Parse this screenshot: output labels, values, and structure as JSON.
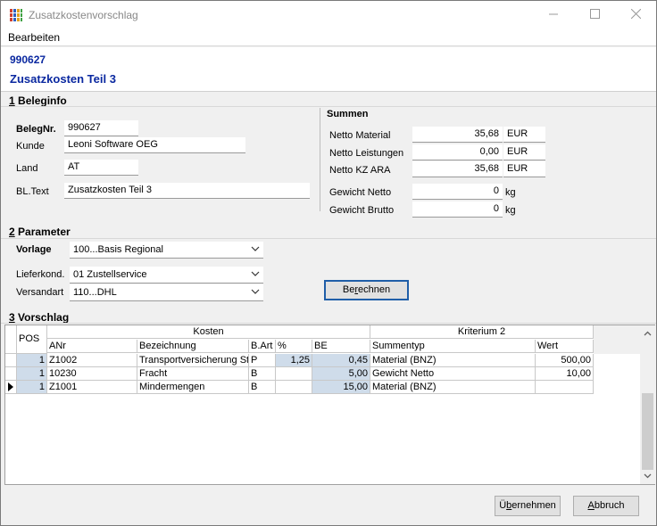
{
  "window": {
    "title": "Zusatzkostenvorschlag"
  },
  "menu": {
    "edit": "Bearbeiten"
  },
  "header": {
    "number": "990627",
    "title": "Zusatzkosten Teil 3"
  },
  "beleginfo": {
    "section_prefix": "1",
    "section_label": " Beleginfo",
    "belegnr_label": "BelegNr.",
    "belegnr": "990627",
    "kunde_label": "Kunde",
    "kunde": "Leoni Software OEG",
    "land_label": "Land",
    "land": "AT",
    "bltext_label": "BL.Text",
    "bltext": "Zusatzkosten Teil 3"
  },
  "summen": {
    "title": "Summen",
    "netto_material_label": "Netto Material",
    "netto_material": "35,68",
    "netto_material_unit": "EUR",
    "netto_leistungen_label": "Netto Leistungen",
    "netto_leistungen": "0,00",
    "netto_leistungen_unit": "EUR",
    "netto_kz_ara_label": "Netto KZ ARA",
    "netto_kz_ara": "35,68",
    "netto_kz_ara_unit": "EUR",
    "gewicht_netto_label": "Gewicht Netto",
    "gewicht_netto": "0",
    "gewicht_netto_unit": "kg",
    "gewicht_brutto_label": "Gewicht Brutto",
    "gewicht_brutto": "0",
    "gewicht_brutto_unit": "kg"
  },
  "parameter": {
    "section_prefix": "2",
    "section_label": " Parameter",
    "vorlage_label": "Vorlage",
    "vorlage": "100...Basis Regional",
    "lieferkond_label": "Lieferkond.",
    "lieferkond": "01 Zustellservice",
    "versandart_label": "Versandart",
    "versandart": "110...DHL",
    "berechnen_pre": "Be",
    "berechnen_u": "r",
    "berechnen_post": "echnen"
  },
  "vorschlag": {
    "section_prefix": "3",
    "section_label": " Vorschlag",
    "group_kosten": "Kosten",
    "group_kriterium": "Kriterium 2",
    "columns": {
      "pos": "POS",
      "anr": "ANr",
      "bezeichnung": "Bezeichnung",
      "bart": "B.Art",
      "pct": "%",
      "be": "BE",
      "summentyp": "Summentyp",
      "wert": "Wert"
    },
    "rows": [
      {
        "pos": "1",
        "anr": "Z1002",
        "bezeichnung": "Transportversicherung St",
        "bart": "P",
        "pct": "1,25",
        "be": "0,45",
        "summentyp": "Material (BNZ)",
        "wert": "500,00"
      },
      {
        "pos": "1",
        "anr": "10230",
        "bezeichnung": "Fracht",
        "bart": "B",
        "pct": "",
        "be": "5,00",
        "summentyp": "Gewicht Netto",
        "wert": "10,00"
      },
      {
        "pos": "1",
        "anr": "Z1001",
        "bezeichnung": "Mindermengen",
        "bart": "B",
        "pct": "",
        "be": "15,00",
        "summentyp": "Material (BNZ)",
        "wert": ""
      }
    ]
  },
  "buttons": {
    "uebernehmen_pre": "Ü",
    "uebernehmen_u": "b",
    "uebernehmen_post": "ernehmen",
    "abbruch_u": "A",
    "abbruch_post": "bbruch"
  },
  "colors": {
    "accent": "#0a28a0",
    "grid_highlight": "#cfdcea"
  }
}
